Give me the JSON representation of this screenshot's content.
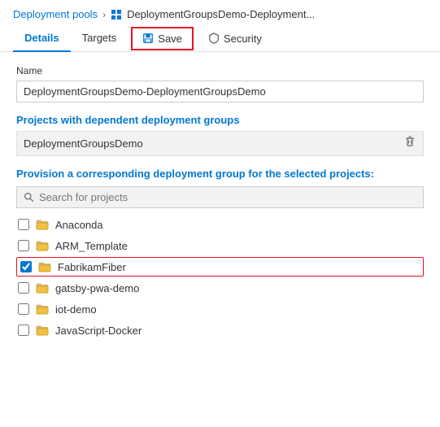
{
  "breadcrumb": {
    "link_label": "Deployment pools",
    "separator": ">",
    "current_label": "DeploymentGroupsDemo-Deployment..."
  },
  "tabs": {
    "details_label": "Details",
    "targets_label": "Targets",
    "save_label": "Save",
    "security_label": "Security"
  },
  "name_field": {
    "label": "Name",
    "value": "DeploymentGroupsDemo-DeploymentGroupsDemo"
  },
  "dependent_projects": {
    "section_label": "Projects with dependent deployment groups",
    "project_name": "DeploymentGroupsDemo"
  },
  "provision": {
    "label": "Provision a corresponding deployment group for the selected projects:",
    "search_placeholder": "Search for projects",
    "projects": [
      {
        "id": "p1",
        "name": "Anaconda",
        "checked": false
      },
      {
        "id": "p2",
        "name": "ARM_Template",
        "checked": false
      },
      {
        "id": "p3",
        "name": "FabrikamFiber",
        "checked": true
      },
      {
        "id": "p4",
        "name": "gatsby-pwa-demo",
        "checked": false
      },
      {
        "id": "p5",
        "name": "iot-demo",
        "checked": false
      },
      {
        "id": "p6",
        "name": "JavaScript-Docker",
        "checked": false
      }
    ]
  }
}
